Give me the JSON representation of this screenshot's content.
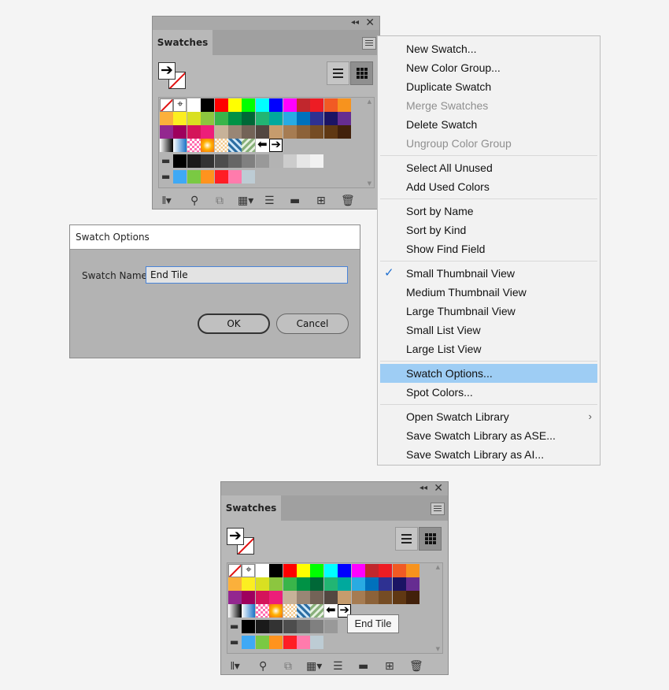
{
  "panel": {
    "tab_label": "Swatches",
    "collapse_glyph": "◂◂",
    "close_glyph": "✕"
  },
  "dialog": {
    "title": "Swatch Options",
    "name_label": "Swatch Name:",
    "name_value": "End Tile",
    "ok_label": "OK",
    "cancel_label": "Cancel"
  },
  "menu": {
    "items": [
      {
        "label": "New Swatch..."
      },
      {
        "label": "New Color Group..."
      },
      {
        "label": "Duplicate Swatch"
      },
      {
        "label": "Merge Swatches",
        "disabled": true
      },
      {
        "label": "Delete Swatch"
      },
      {
        "label": "Ungroup Color Group",
        "disabled": true
      },
      {
        "label": "Select All Unused"
      },
      {
        "label": "Add Used Colors"
      },
      {
        "label": "Sort by Name"
      },
      {
        "label": "Sort by Kind"
      },
      {
        "label": "Show Find Field"
      },
      {
        "label": "Small Thumbnail View",
        "checked": true
      },
      {
        "label": "Medium Thumbnail View"
      },
      {
        "label": "Large Thumbnail View"
      },
      {
        "label": "Small List View"
      },
      {
        "label": "Large List View"
      },
      {
        "label": "Swatch Options...",
        "highlighted": true
      },
      {
        "label": "Spot Colors..."
      },
      {
        "label": "Open Swatch Library",
        "submenu": true
      },
      {
        "label": "Save Swatch Library as ASE..."
      },
      {
        "label": "Save Swatch Library as AI..."
      }
    ],
    "check_glyph": "✓",
    "submenu_glyph": "›"
  },
  "tooltip": {
    "text": "End Tile"
  },
  "swatch_rows": {
    "row1": [
      "none",
      "registration",
      "#ffffff",
      "#000000",
      "#ff0000",
      "#ffff00",
      "#00ff00",
      "#00ffff",
      "#0000ff",
      "#ff00ff",
      "#c1272d",
      "#ed1c24",
      "#f15a24",
      "#f7931e"
    ],
    "row2": [
      "#fbb03b",
      "#fcee21",
      "#d9e021",
      "#8cc63f",
      "#39b54a",
      "#009245",
      "#006837",
      "#22b573",
      "#00a99d",
      "#29abe2",
      "#0071bc",
      "#2e3192",
      "#1b1464",
      "#662d91"
    ],
    "row3": [
      "#93278f",
      "#9e005d",
      "#d4145a",
      "#ed1e79",
      "#c7b299",
      "#998675",
      "#736357",
      "#534741",
      "#c69c6d",
      "#a67c52",
      "#8c6239",
      "#754c24",
      "#603813",
      "#42210b"
    ],
    "row5": [
      "#000000",
      "#1a1a1a",
      "#333333",
      "#4d4d4d",
      "#666666",
      "#808080",
      "#999999",
      "#b3b3b3",
      "#cccccc",
      "#e6e6e6",
      "#f2f2f2"
    ],
    "row6": [
      "#3fa9f5",
      "#7ac943",
      "#ff931e",
      "#ff1d25",
      "#ff7bac",
      "#bdccd4"
    ]
  },
  "colors": {
    "highlight": "#9ecdf4",
    "check": "#1f6fd0",
    "input_focus": "#4a84d8"
  },
  "icons": [
    "libraries-menu-icon",
    "show-kinds-icon",
    "swatch-options-icon",
    "color-group-icon",
    "new-group-icon",
    "folder-icon",
    "new-swatch-icon",
    "trash-icon"
  ]
}
